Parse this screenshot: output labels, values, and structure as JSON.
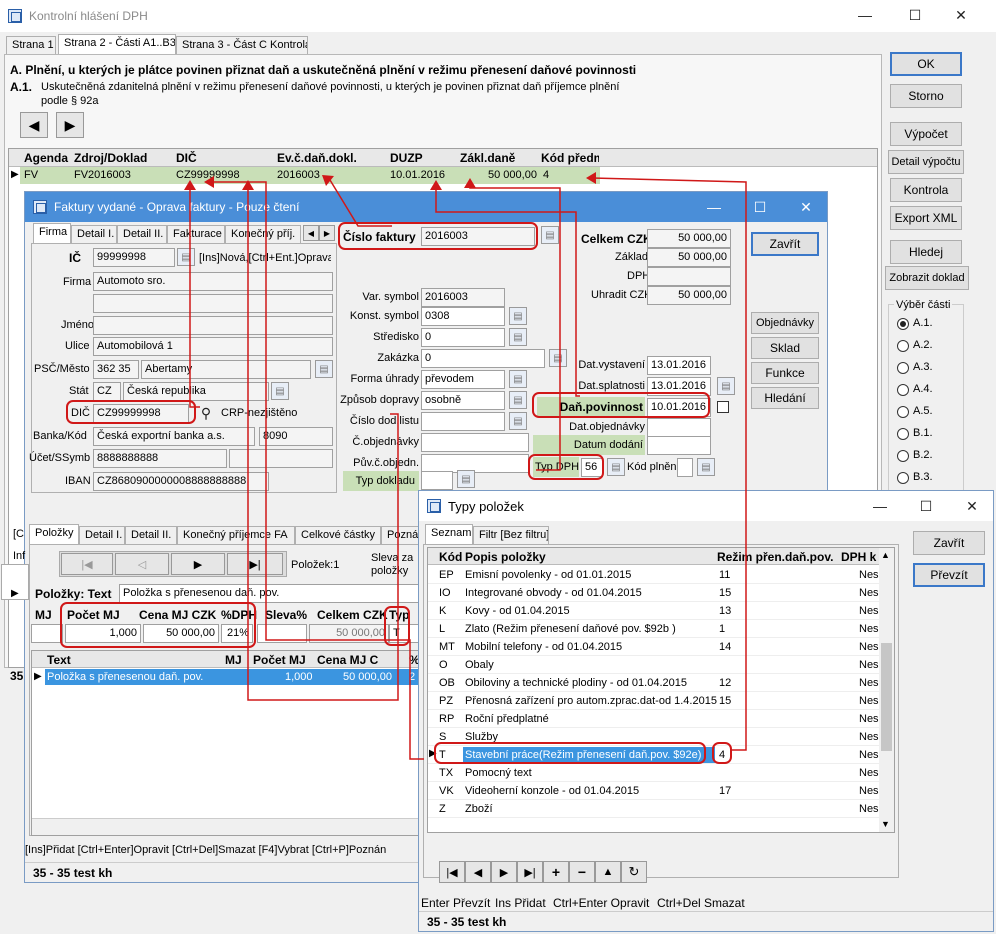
{
  "main": {
    "title": "Kontrolní hlášení DPH",
    "tabs": [
      "Strana 1",
      "Strana 2 - Části A1..B3",
      "Strana 3 - Část C Kontrola"
    ],
    "section_title": "A. Plnění, u kterých je plátce povinen přiznat daň a uskutečněná plnění v režimu přenesení daňové povinnosti",
    "section_sub_num": "A.1.",
    "section_sub_text": "Uskutečněná zdanitelná plnění v režimu přenesení daňové povinnosti, u kterých je povinen přiznat daň příjemce plnění podle § 92a",
    "grid_headers": [
      "Agenda",
      "Zdroj/Doklad",
      "DIČ",
      "Ev.č.daň.dokl.",
      "DUZP",
      "Zákl.daně",
      "Kód předm"
    ],
    "grid_row": [
      "FV",
      "FV2016003",
      "CZ99999998",
      "2016003",
      "10.01.2016",
      "50 000,00",
      "4"
    ],
    "buttons": [
      "OK",
      "Storno",
      "Výpočet",
      "Detail výpočtu",
      "Kontrola",
      "Export XML",
      "Hledej",
      "Zobrazit doklad"
    ],
    "vyber_label": "Výběr části",
    "radios": [
      "A.1.",
      "A.2.",
      "A.3.",
      "A.4.",
      "A.5.",
      "B.1.",
      "B.2.",
      "B.3."
    ],
    "status_left": "35"
  },
  "invoice": {
    "title": "Faktury vydané - Oprava faktury - Pouze čtení",
    "tabs": [
      "Firma",
      "Detail I.",
      "Detail II.",
      "Fakturace",
      "Konečný příj."
    ],
    "ic_label": "IČ",
    "ic": "99999998",
    "ins_hint": "[Ins]Nová,[Ctrl+Ent.]Oprava",
    "firma_label": "Firma",
    "firma": "Automoto sro.",
    "jmeno_label": "Jméno",
    "ulice_label": "Ulice",
    "ulice": "Automobilová 1",
    "psc_label": "PSČ/Město",
    "psc": "362 35",
    "mesto": "Abertamy",
    "stat_label": "Stát",
    "stat_code": "CZ",
    "stat": "Česká republika",
    "dic_label": "DIČ",
    "dic": "CZ99999998",
    "crp": "CRP-nezjištěno",
    "banka_label": "Banka/Kód",
    "banka": "Česká exportní banka a.s.",
    "banka_kod": "8090",
    "ucet_label": "Účet/SSymb",
    "ucet": "8888888888",
    "iban_label": "IBAN",
    "iban": "CZ8680900000008888888888",
    "cislo_label": "Číslo faktury",
    "cislo": "2016003",
    "var_label": "Var. symbol",
    "var": "2016003",
    "konst_label": "Konst. symbol",
    "konst": "0308",
    "stredisko_label": "Středisko",
    "stredisko": "0",
    "zakazka_label": "Zakázka",
    "zakazka": "0",
    "forma_label": "Forma úhrady",
    "forma": "převodem",
    "zpusob_label": "Způsob dopravy",
    "zpusob": "osobně",
    "cislo_dod_label": "Číslo dod.listu",
    "cobj_label": "Č.objednávky",
    "puv_label": "Pův.č.objedn.",
    "typ_dokladu_label": "Typ dokladu",
    "celkem_label": "Celkem CZK",
    "celkem": "50 000,00",
    "zaklad_label": "Základ",
    "zaklad": "50 000,00",
    "dph_label": "DPH",
    "uhradit_label": "Uhradit CZK",
    "uhradit": "50 000,00",
    "dat_vyst_label": "Dat.vystavení",
    "dat_vyst": "13.01.2016",
    "dat_spl_label": "Dat.splatnosti",
    "dat_spl": "13.01.2016",
    "dan_pov_label": "Daň.povinnost",
    "dan_pov": "10.01.2016",
    "dat_obj_label": "Dat.objednávky",
    "datum_dod_label": "Datum dodání",
    "typ_dph_label": "Typ DPH",
    "typ_dph": "56",
    "kod_plneni_label": "Kód plnění",
    "buttons": [
      "Zavřít",
      "Objednávky",
      "Sklad",
      "Funkce",
      "Hledání"
    ],
    "lower_tabs": [
      "Položky",
      "Detail I.",
      "Detail II.",
      "Konečný příjemce FA",
      "Celkové částky",
      "Poznán"
    ],
    "items_count": "Položek:1",
    "sleva_label": "Sleva za položky",
    "polozky_text_label": "Položky: Text",
    "polozky_text": "Položka s přenesenou daň. pov.",
    "item_headers": [
      "MJ",
      "Počet MJ",
      "Cena MJ CZK",
      "%DPH",
      "Sleva%",
      "Celkem CZK",
      "Typ"
    ],
    "item_values": [
      "",
      "1,000",
      "50 000,00",
      "21%",
      "",
      "50 000,00",
      "T"
    ],
    "list_headers": [
      "Text",
      "MJ",
      "Počet MJ",
      "Cena MJ C",
      "%"
    ],
    "list_row": [
      "Položka s přenesenou daň. pov.",
      "",
      "1,000",
      "50 000,00",
      "2"
    ],
    "hotkeys": "[Ins]Přidat [Ctrl+Enter]Opravit [Ctrl+Del]Smazat [F4]Vybrat [Ctrl+P]Poznán",
    "status": "35 - 35 test kh",
    "left_stubs": [
      "[C",
      "Inf"
    ]
  },
  "types": {
    "title": "Typy položek",
    "tabs": [
      "Seznam",
      "Filtr [Bez filtru]"
    ],
    "headers": [
      "Kód",
      "Popis položky",
      "Režim přen.daň.pov.",
      "DPH k"
    ],
    "rows": [
      {
        "kod": "EP",
        "popis": "Emisní povolenky - od 01.01.2015",
        "rezim": "11",
        "dph": "Nes"
      },
      {
        "kod": "IO",
        "popis": "Integrované obvody - od 01.04.2015",
        "rezim": "15",
        "dph": "Nes"
      },
      {
        "kod": "K",
        "popis": "Kovy - od 01.04.2015",
        "rezim": "13",
        "dph": "Nes"
      },
      {
        "kod": "L",
        "popis": "Zlato (Režim přenesení daňové pov. $92b )",
        "rezim": "1",
        "dph": "Nes"
      },
      {
        "kod": "MT",
        "popis": "Mobilní telefony - od 01.04.2015",
        "rezim": "14",
        "dph": "Nes"
      },
      {
        "kod": "O",
        "popis": "Obaly",
        "rezim": "",
        "dph": "Nes"
      },
      {
        "kod": "OB",
        "popis": "Obiloviny a technické plodiny - od 01.04.2015",
        "rezim": "12",
        "dph": "Nes"
      },
      {
        "kod": "PZ",
        "popis": "Přenosná zařízení pro autom.zprac.dat-od 1.4.2015",
        "rezim": "15",
        "dph": "Nes"
      },
      {
        "kod": "RP",
        "popis": "Roční předplatné",
        "rezim": "",
        "dph": "Nes"
      },
      {
        "kod": "S",
        "popis": "Služby",
        "rezim": "",
        "dph": "Nes"
      },
      {
        "kod": "T",
        "popis": "Stavební práce(Režim přenesení daň.pov. $92e)",
        "rezim": "4",
        "dph": "Nes"
      },
      {
        "kod": "TX",
        "popis": "Pomocný text",
        "rezim": "",
        "dph": "Nes"
      },
      {
        "kod": "VK",
        "popis": "Videoherní konzole - od 01.04.2015",
        "rezim": "17",
        "dph": "Nes"
      },
      {
        "kod": "Z",
        "popis": "Zboží",
        "rezim": "",
        "dph": "Nes"
      }
    ],
    "buttons": [
      "Zavřít",
      "Převzít"
    ],
    "hotkeys": [
      "Enter Převzít",
      "Ins Přidat",
      "Ctrl+Enter Opravit",
      "Ctrl+Del Smazat"
    ],
    "status": "35 - 35 test kh"
  }
}
